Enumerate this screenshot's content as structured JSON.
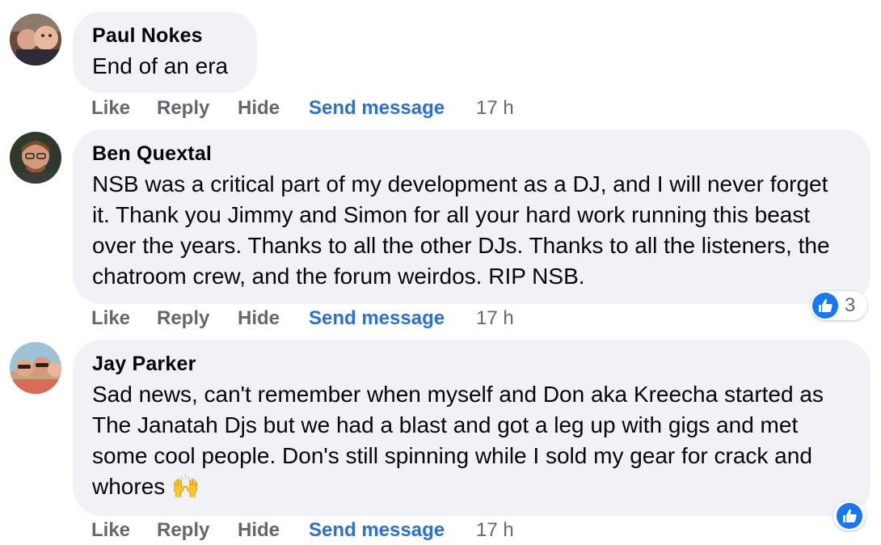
{
  "comments": [
    {
      "author": "Paul Nokes",
      "text": "End of an era",
      "actions": {
        "like": "Like",
        "reply": "Reply",
        "hide": "Hide",
        "send_message": "Send message",
        "time": "17 h"
      }
    },
    {
      "author": "Ben Quextal",
      "text": "NSB was a critical part of my development as a DJ, and I will never forget it. Thank you Jimmy and Simon for all your hard work running this beast over the years. Thanks to all the other DJs. Thanks to all the listeners, the chatroom crew, and the forum weirdos. RIP NSB.",
      "actions": {
        "like": "Like",
        "reply": "Reply",
        "hide": "Hide",
        "send_message": "Send message",
        "time": "17 h"
      },
      "reaction": {
        "icon": "thumbs-up-icon",
        "count": "3"
      }
    },
    {
      "author": "Jay Parker",
      "text": "Sad news, can't remember when myself and Don aka Kreecha started as The Janatah Djs but we had a blast and got a leg up with gigs and met some cool people. Don's still spinning while I sold my gear for crack and whores 🙌",
      "actions": {
        "like": "Like",
        "reply": "Reply",
        "hide": "Hide",
        "send_message": "Send message",
        "time": "17 h"
      },
      "reaction": {
        "icon": "thumbs-up-icon"
      }
    }
  ],
  "colors": {
    "bubble": "#f0f2f5",
    "action_gray": "#65676b",
    "link_blue": "#2d6fd2",
    "like_blue": "#1877f2"
  }
}
